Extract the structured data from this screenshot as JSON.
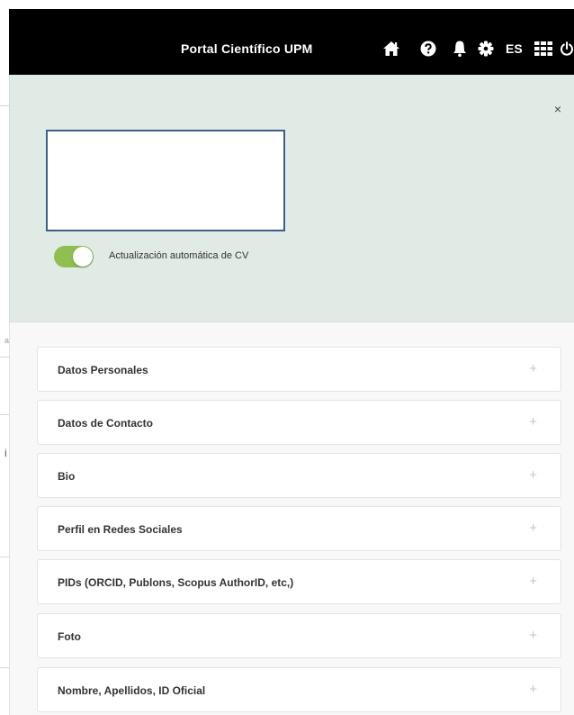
{
  "topbar": {
    "brand": "Portal Científico UPM",
    "language": "ES",
    "icons": [
      "home-icon",
      "help-icon",
      "bell-icon",
      "gear-icon",
      "apps-grid-icon",
      "power-icon"
    ]
  },
  "panel": {
    "close_label": "×",
    "toggle_label": "Actualización automática de CV",
    "toggle_on": true,
    "accent_color": "#8fbf50",
    "plus_label": "+",
    "sections": [
      {
        "title": "Datos Personales"
      },
      {
        "title": "Datos de Contacto"
      },
      {
        "title": "Bio"
      },
      {
        "title": "Perfil en Redes Sociales"
      },
      {
        "title": "PIDs (ORCID, Publons, Scopus AuthorID, etc,)"
      },
      {
        "title": "Foto"
      },
      {
        "title": "Nombre, Apellidos, ID Oficial"
      }
    ]
  },
  "background": {
    "fragment_left_1": "a",
    "fragment_left_2": "i"
  }
}
